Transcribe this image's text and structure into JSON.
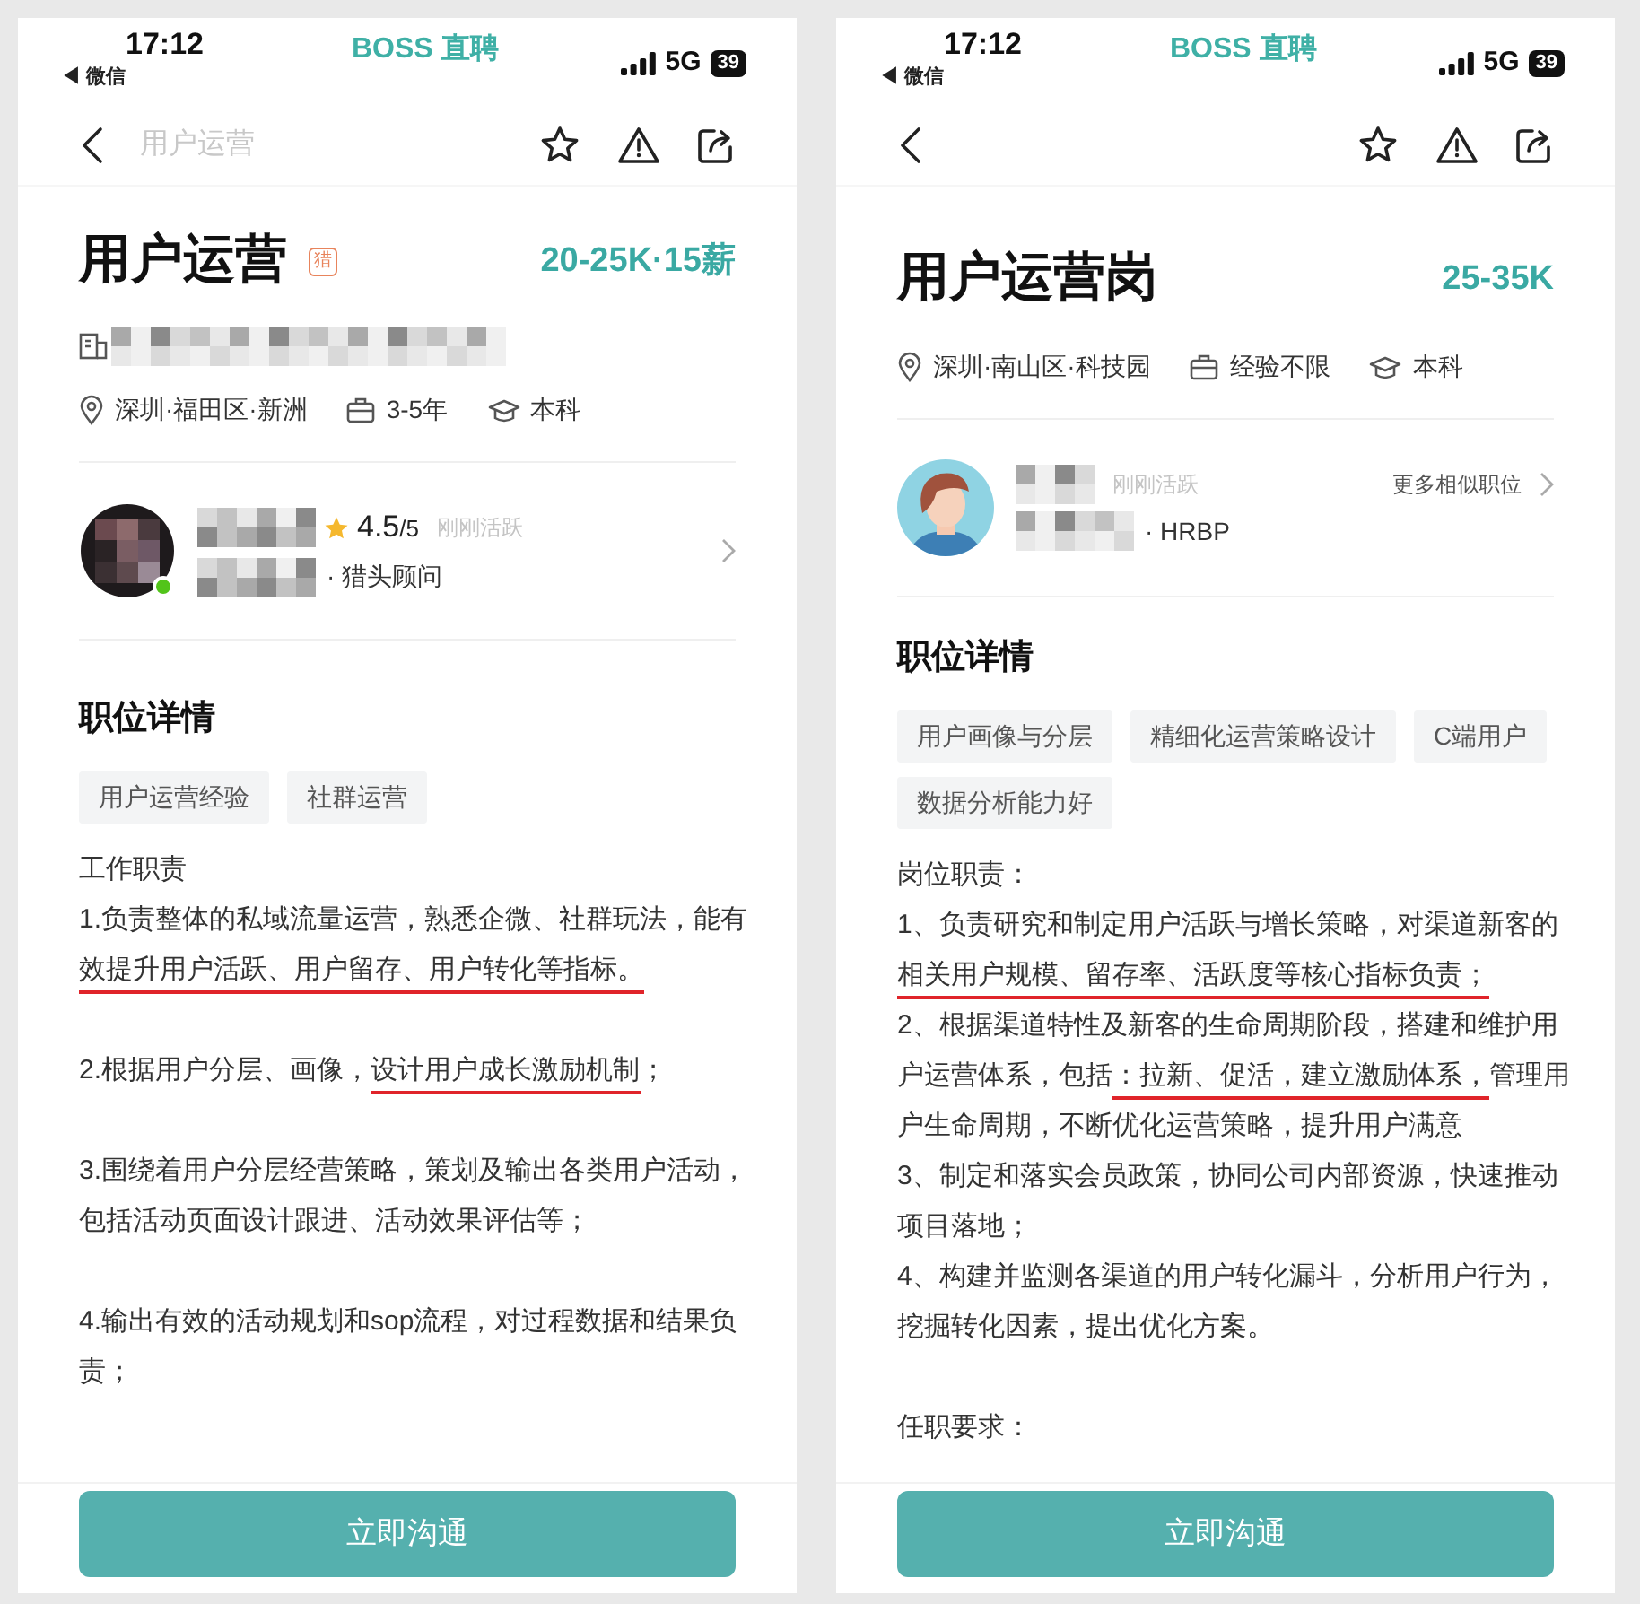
{
  "phones": [
    {
      "status_bar": {
        "time": "17:12",
        "back_app": "◀ 微信",
        "app_name": "BOSS 直聘",
        "network": "5G",
        "battery": "39"
      },
      "nav": {
        "title": "用户运营"
      },
      "job": {
        "title": "用户运营",
        "badge": "猎",
        "salary": "20-25K·15薪",
        "company": {
          "kind": "redacted"
        },
        "meta": [
          {
            "kind": "location",
            "text": "深圳·福田区·新洲"
          },
          {
            "kind": "experience",
            "text": "3-5年"
          },
          {
            "kind": "education",
            "text": "本科"
          }
        ]
      },
      "recruiter": {
        "avatar": {
          "kind": "pixelated"
        },
        "online": true,
        "rating": "4.5",
        "rating_max": "/5",
        "activity": "刚刚活跃",
        "role": "· 猎头顾问"
      },
      "details": {
        "heading": "职位详情",
        "tags": [
          "用户运营经验",
          "社群运营"
        ],
        "paragraphs": [
          {
            "blank_line_before": false,
            "segments": [
              {
                "text": "工作职责",
                "underlined": false
              }
            ]
          },
          {
            "blank_line_before": false,
            "segments": [
              {
                "text": "1.负责整体的私域流量运营，熟悉企微、社群玩法，能有",
                "underlined": false
              },
              {
                "text": "效提升用户活跃、用户留存、用户转化等指标。",
                "underlined": true
              }
            ]
          },
          {
            "blank_line_before": true,
            "segments": [
              {
                "text": "2.根据用户分层、画像，",
                "underlined": false
              },
              {
                "text": "设计用户成长激励机制",
                "underlined": true
              },
              {
                "text": "；",
                "underlined": false
              }
            ]
          },
          {
            "blank_line_before": true,
            "segments": [
              {
                "text": "3.围绕着用户分层经营策略，策划及输出各类用户活动，包括活动页面设计跟进、活动效果评估等；",
                "underlined": false
              }
            ]
          },
          {
            "blank_line_before": true,
            "segments": [
              {
                "text": "4.输出有效的活动规划和sop流程，对过程数据和结果负责；",
                "underlined": false
              }
            ]
          }
        ]
      },
      "action_button": "立即沟通"
    },
    {
      "status_bar": {
        "time": "17:12",
        "back_app": "◀ 微信",
        "app_name": "BOSS 直聘",
        "network": "5G",
        "battery": "39"
      },
      "job": {
        "title": "用户运营岗",
        "salary": "25-35K",
        "meta": [
          {
            "kind": "location",
            "text": "深圳·南山区·科技园"
          },
          {
            "kind": "experience",
            "text": "经验不限"
          },
          {
            "kind": "education",
            "text": "本科"
          }
        ]
      },
      "recruiter": {
        "avatar": {
          "kind": "illustration"
        },
        "online": false,
        "activity": "刚刚活跃",
        "role": "· HRBP",
        "more_link": "更多相似职位"
      },
      "details": {
        "heading": "职位详情",
        "tags": [
          "用户画像与分层",
          "精细化运营策略设计",
          "C端用户",
          "数据分析能力好"
        ],
        "paragraphs": [
          {
            "blank_line_before": false,
            "segments": [
              {
                "text": "岗位职责：",
                "underlined": false
              }
            ]
          },
          {
            "blank_line_before": false,
            "segments": [
              {
                "text": "1、负责研究和制定用户活跃与增长策略，对渠道新客的",
                "underlined": false
              },
              {
                "text": "相关用户规模、留存率、活跃度等核心指标负责；",
                "underlined": true
              }
            ]
          },
          {
            "blank_line_before": false,
            "segments": [
              {
                "text": "2、根据渠道特性及新客的生命周期阶段，搭建和维护用户运营体系，包括",
                "underlined": false
              },
              {
                "text": "：拉新、促活，建立激励体系，",
                "underlined": true
              },
              {
                "text": "管理用户生命周期，不断优化运营策略，提升用户满意",
                "underlined": false
              }
            ]
          },
          {
            "blank_line_before": false,
            "segments": [
              {
                "text": "3、制定和落实会员政策，协同公司内部资源，快速推动项目落地；",
                "underlined": false
              }
            ]
          },
          {
            "blank_line_before": false,
            "segments": [
              {
                "text": "4、构建并监测各渠道的用户转化漏斗，分析用户行为，挖掘转化因素，提出优化方案。",
                "underlined": false
              }
            ]
          },
          {
            "blank_line_before": true,
            "segments": [
              {
                "text": "任职要求：",
                "underlined": false
              }
            ]
          }
        ]
      },
      "action_button": "立即沟通"
    }
  ]
}
